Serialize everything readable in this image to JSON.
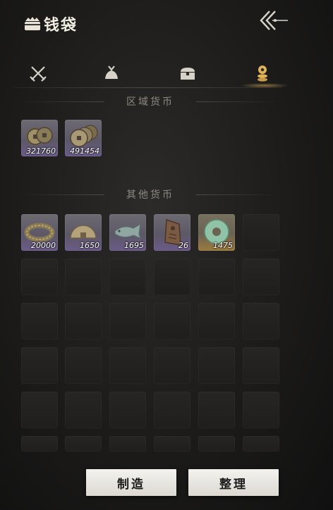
{
  "header": {
    "title": "钱袋",
    "title_icon": "pouch-icon",
    "back_icon": "double-chevron-back-icon"
  },
  "tabs": [
    {
      "icon": "crossed-swords-icon",
      "active": false
    },
    {
      "icon": "bundle-icon",
      "active": false
    },
    {
      "icon": "chest-icon",
      "active": false
    },
    {
      "icon": "coin-stack-icon",
      "active": true
    }
  ],
  "sections": {
    "regional": "区域货币",
    "other": "其他货币"
  },
  "regional_currency": [
    {
      "icon": "copper-coins-icon",
      "quantity": "321760"
    },
    {
      "icon": "copper-coins-stack-icon",
      "quantity": "491454"
    }
  ],
  "other_currency": [
    {
      "icon": "coin-string-icon",
      "quantity": "20000"
    },
    {
      "icon": "half-coin-icon",
      "quantity": "1650"
    },
    {
      "icon": "jade-fish-icon",
      "quantity": "1695"
    },
    {
      "icon": "bronze-token-icon",
      "quantity": "26"
    },
    {
      "icon": "jade-disc-icon",
      "quantity": "1475"
    }
  ],
  "buttons": {
    "craft": "制造",
    "sort": "整理"
  },
  "colors": {
    "accent": "#e0b25a",
    "rare_slot": "#6a5a88",
    "legendary_slot": "#9a7a3e"
  }
}
